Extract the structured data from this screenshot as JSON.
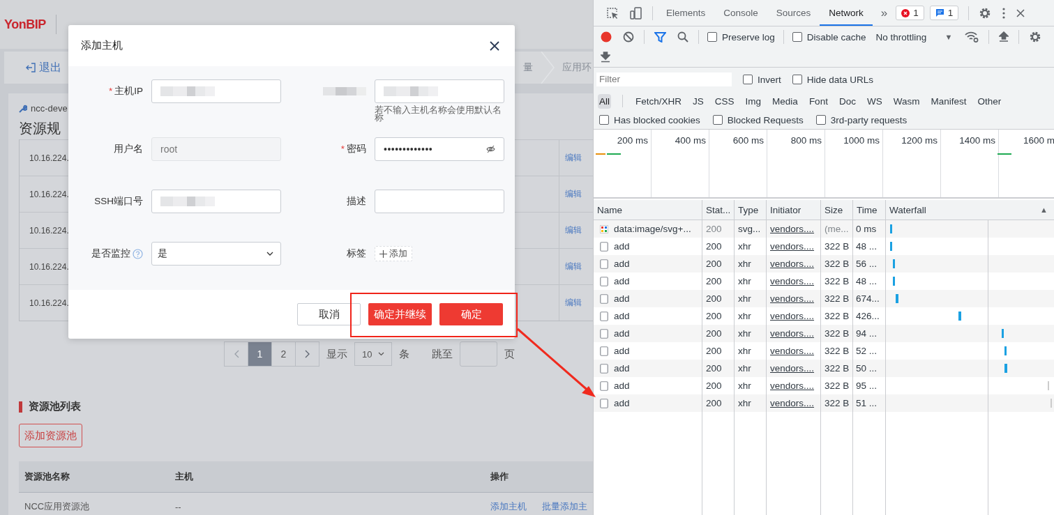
{
  "app": {
    "logo": "YonBIP",
    "exit_button": "退出",
    "steps": [
      "量",
      "应用环"
    ],
    "breadcrumb": "ncc-deve",
    "section_title": "资源规",
    "host_rows": [
      {
        "ip": "10.16.224.",
        "action": "编辑"
      },
      {
        "ip": "10.16.224.",
        "action": "编辑"
      },
      {
        "ip": "10.16.224.",
        "action": "编辑"
      },
      {
        "ip": "10.16.224.",
        "action": "编辑"
      },
      {
        "ip": "10.16.224.",
        "action": "编辑"
      }
    ],
    "pagination": {
      "pages": [
        {
          "label": "1",
          "selected": true
        },
        {
          "label": "2",
          "selected": false
        }
      ],
      "show_label": "显示",
      "page_size": "10",
      "unit": "条",
      "jump_label": "跳至",
      "page_label": "页"
    },
    "pool_section": {
      "title": "资源池列表",
      "add_button": "添加资源池",
      "columns": [
        "资源池名称",
        "主机",
        "操作"
      ],
      "rows": [
        {
          "name": "NCC应用资源池",
          "hosts": "--",
          "actions": [
            "添加主机",
            "批量添加主"
          ]
        }
      ]
    }
  },
  "dialog": {
    "title": "添加主机",
    "required_mark": "*",
    "fields": [
      {
        "label": "主机IP",
        "required": true,
        "kind": "blurred"
      },
      {
        "required": false,
        "kind": "blurred",
        "hint": "若不输入主机名称会使用默认名称"
      },
      {
        "label": "用户名",
        "required": false,
        "kind": "text",
        "value": "root",
        "disabled": true
      },
      {
        "label": "密码",
        "required": true,
        "kind": "password",
        "value": "•••••••••••••"
      },
      {
        "label": "SSH端口号",
        "required": false,
        "kind": "blurred"
      },
      {
        "label": "描述",
        "required": false,
        "kind": "text",
        "disabled": false
      },
      {
        "label": "是否监控",
        "required": false,
        "kind": "select",
        "value": "是",
        "help": true
      },
      {
        "label": "标签",
        "required": false,
        "kind": "tag",
        "value": "添加"
      }
    ],
    "buttons": [
      {
        "label": "取消",
        "kind": "default"
      },
      {
        "label": "确定并继续",
        "kind": "primary"
      },
      {
        "label": "确定",
        "kind": "primary"
      }
    ]
  },
  "devtools": {
    "tabs": [
      {
        "label": "Elements",
        "selected": false
      },
      {
        "label": "Console",
        "selected": false
      },
      {
        "label": "Sources",
        "selected": false
      },
      {
        "label": "Network",
        "selected": true
      }
    ],
    "more": "»",
    "error_count": "1",
    "message_count": "1",
    "preserve_log": {
      "label": "Preserve log",
      "checked": false
    },
    "disable_cache": {
      "label": "Disable cache",
      "checked": false
    },
    "throttling": "No throttling",
    "throttling_caret": "▼",
    "filter": {
      "placeholder": "Filter"
    },
    "filter_options": [
      {
        "label": "Invert",
        "checked": false
      },
      {
        "label": "Hide data URLs",
        "checked": false
      }
    ],
    "types": [
      {
        "label": "All",
        "selected": true
      },
      {
        "label": "Fetch/XHR",
        "selected": false
      },
      {
        "label": "JS",
        "selected": false
      },
      {
        "label": "CSS",
        "selected": false
      },
      {
        "label": "Img",
        "selected": false
      },
      {
        "label": "Media",
        "selected": false
      },
      {
        "label": "Font",
        "selected": false
      },
      {
        "label": "Doc",
        "selected": false
      },
      {
        "label": "WS",
        "selected": false
      },
      {
        "label": "Wasm",
        "selected": false
      },
      {
        "label": "Manifest",
        "selected": false
      },
      {
        "label": "Other",
        "selected": false
      }
    ],
    "blocked_options": [
      {
        "label": "Has blocked cookies",
        "checked": false
      },
      {
        "label": "Blocked Requests",
        "checked": false
      },
      {
        "label": "3rd-party requests",
        "checked": false
      }
    ],
    "overview_ticks": [
      "200 ms",
      "400 ms",
      "600 ms",
      "800 ms",
      "1000 ms",
      "1200 ms",
      "1400 ms",
      "1600 m"
    ],
    "columns": [
      "Name",
      "Stat...",
      "Type",
      "Initiator",
      "Size",
      "Time",
      "Waterfall"
    ],
    "sort_indicator": "▲",
    "rows": [
      {
        "kind": "image",
        "name": "data:image/svg+...",
        "status": "200",
        "type": "svg...",
        "initiator": "vendors....",
        "size": "(me...",
        "time": "0 ms"
      },
      {
        "kind": "xhr",
        "name": "add",
        "status": "200",
        "type": "xhr",
        "initiator": "vendors....",
        "size": "322 B",
        "time": "48 ..."
      },
      {
        "kind": "xhr",
        "name": "add",
        "status": "200",
        "type": "xhr",
        "initiator": "vendors....",
        "size": "322 B",
        "time": "56 ..."
      },
      {
        "kind": "xhr",
        "name": "add",
        "status": "200",
        "type": "xhr",
        "initiator": "vendors....",
        "size": "322 B",
        "time": "48 ..."
      },
      {
        "kind": "xhr",
        "name": "add",
        "status": "200",
        "type": "xhr",
        "initiator": "vendors....",
        "size": "322 B",
        "time": "674..."
      },
      {
        "kind": "xhr",
        "name": "add",
        "status": "200",
        "type": "xhr",
        "initiator": "vendors....",
        "size": "322 B",
        "time": "426..."
      },
      {
        "kind": "xhr",
        "name": "add",
        "status": "200",
        "type": "xhr",
        "initiator": "vendors....",
        "size": "322 B",
        "time": "94 ..."
      },
      {
        "kind": "xhr",
        "name": "add",
        "status": "200",
        "type": "xhr",
        "initiator": "vendors....",
        "size": "322 B",
        "time": "52 ..."
      },
      {
        "kind": "xhr",
        "name": "add",
        "status": "200",
        "type": "xhr",
        "initiator": "vendors....",
        "size": "322 B",
        "time": "50 ..."
      },
      {
        "kind": "xhr",
        "name": "add",
        "status": "200",
        "type": "xhr",
        "initiator": "vendors....",
        "size": "322 B",
        "time": "95 ..."
      },
      {
        "kind": "xhr",
        "name": "add",
        "status": "200",
        "type": "xhr",
        "initiator": "vendors....",
        "size": "322 B",
        "time": "51 ..."
      }
    ]
  }
}
